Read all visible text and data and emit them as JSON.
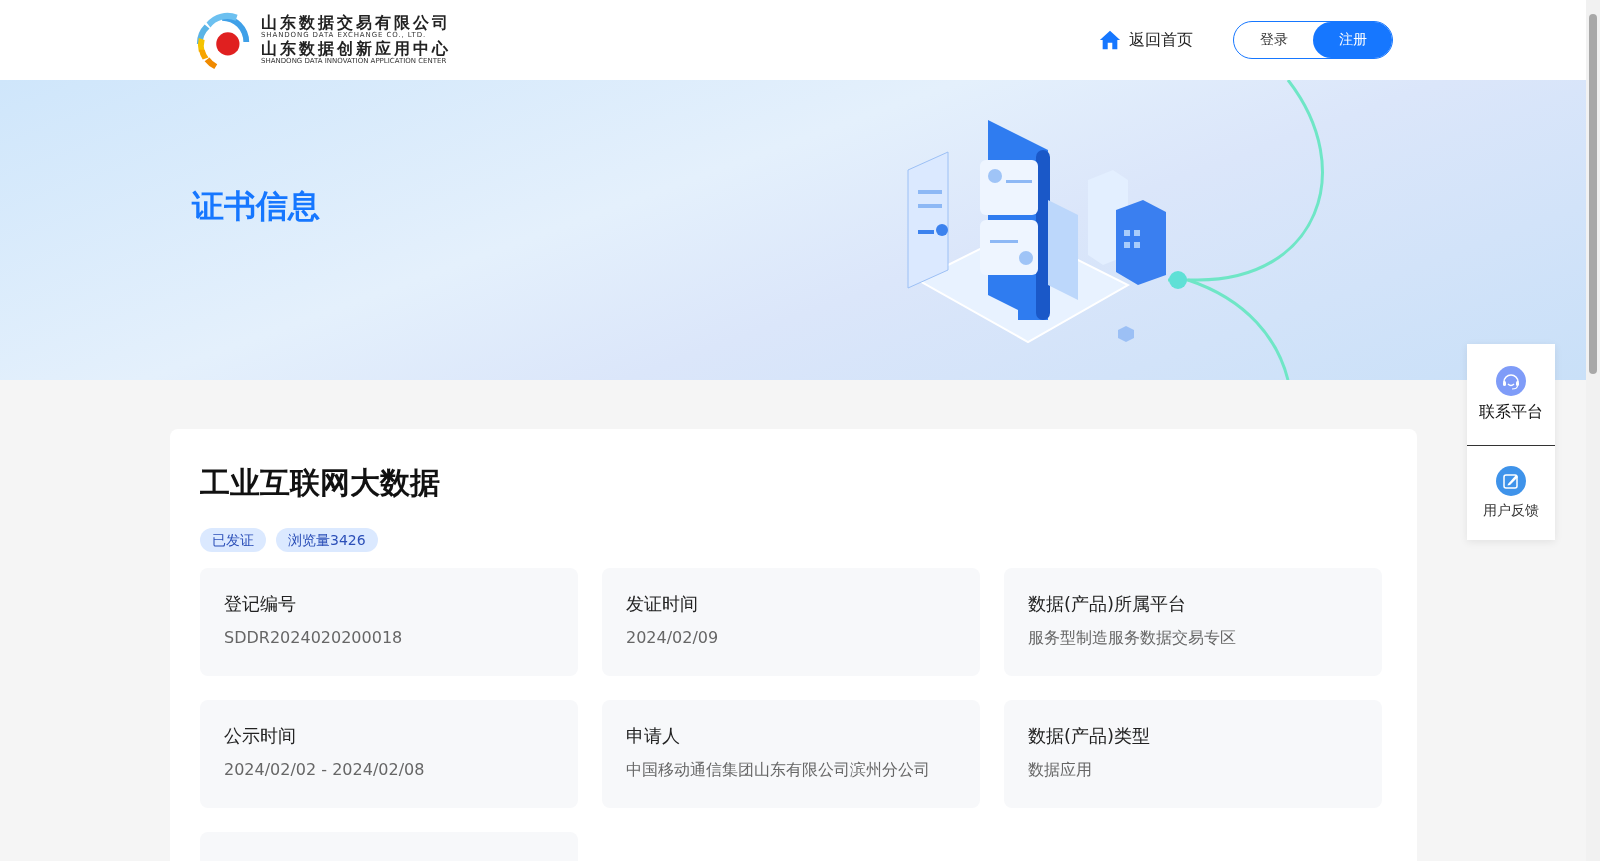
{
  "header": {
    "logo": {
      "company_cn": "山东数据交易有限公司",
      "company_en": "SHANDONG DATA EXCHANGE CO., LTD.",
      "center_cn": "山东数据创新应用中心",
      "center_en": "SHANDONG DATA INNOVATION APPLICATION CENTER"
    },
    "home_link": "返回首页",
    "auth_buttons": [
      {
        "label": "登录",
        "selected": false
      },
      {
        "label": "注册",
        "selected": true
      }
    ]
  },
  "banner": {
    "title": "证书信息"
  },
  "certificate": {
    "title": "工业互联网大数据",
    "tags": [
      "已发证",
      "浏览量3426"
    ],
    "fields": [
      {
        "label": "登记编号",
        "value": "SDDR2024020200018"
      },
      {
        "label": "发证时间",
        "value": "2024/02/09"
      },
      {
        "label": "数据(产品)所属平台",
        "value": "服务型制造服务数据交易专区"
      },
      {
        "label": "公示时间",
        "value": "2024/02/02 - 2024/02/08"
      },
      {
        "label": "申请人",
        "value": "中国移动通信集团山东有限公司滨州分公司"
      },
      {
        "label": "数据(产品)类型",
        "value": "数据应用"
      }
    ],
    "more_cards_below": true
  },
  "side_panel": [
    {
      "kind": "contact",
      "label": "联系平台"
    },
    {
      "kind": "feedback",
      "label": "用户反馈"
    }
  ]
}
